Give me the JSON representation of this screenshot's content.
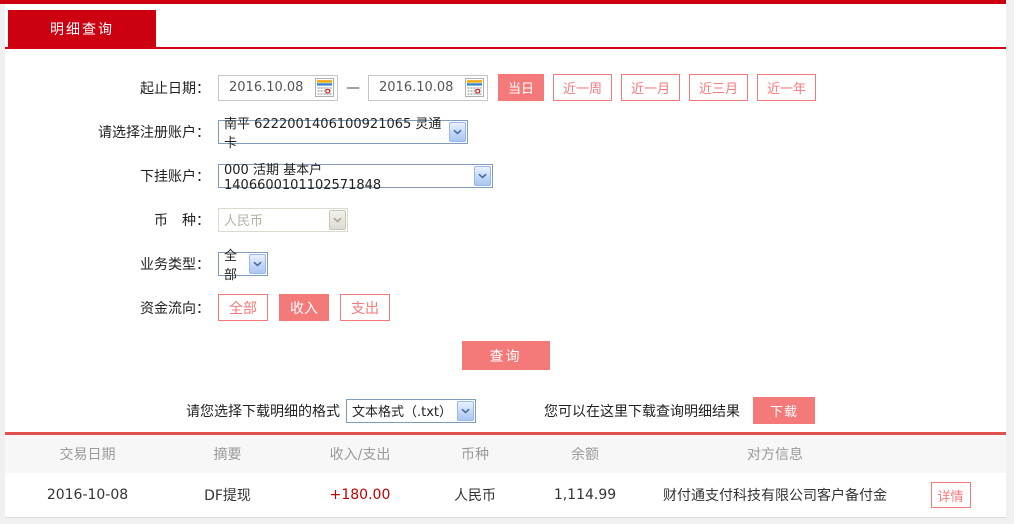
{
  "page": {
    "tab_title": "明细查询"
  },
  "form": {
    "date_range": {
      "label": "起止日期：",
      "start_value": "2016.10.08",
      "end_value": "2016.10.08",
      "separator": "—",
      "quick_buttons": [
        {
          "label": "当日",
          "active": true
        },
        {
          "label": "近一周",
          "active": false
        },
        {
          "label": "近一月",
          "active": false
        },
        {
          "label": "近三月",
          "active": false
        },
        {
          "label": "近一年",
          "active": false
        }
      ]
    },
    "registered_account": {
      "label": "请选择注册账户：",
      "value": "南平 6222001406100921065 灵通卡"
    },
    "sub_account": {
      "label": "下挂账户：",
      "value": "000 活期 基本户 1406600101102571848"
    },
    "currency": {
      "label": "币　种：",
      "value": "人民币",
      "disabled": true
    },
    "business_type": {
      "label": "业务类型：",
      "value": "全部"
    },
    "fund_flow": {
      "label": "资金流向：",
      "options": [
        {
          "label": "全部",
          "active": false
        },
        {
          "label": "收入",
          "active": true
        },
        {
          "label": "支出",
          "active": false
        }
      ]
    },
    "query_button": "查询"
  },
  "download": {
    "format_label": "请您选择下载明细的格式",
    "format_value": "文本格式（.txt）",
    "hint": "您可以在这里下载查询明细结果",
    "button": "下载"
  },
  "table": {
    "headers": [
      "交易日期",
      "摘要",
      "收入/支出",
      "币种",
      "余额",
      "对方信息"
    ],
    "rows": [
      {
        "date": "2016-10-08",
        "summary": "DF提现",
        "amount": "+180.00",
        "currency": "人民币",
        "balance": "1,114.99",
        "counterparty": "财付通支付科技有限公司客户备付金",
        "detail_button": "详情"
      }
    ]
  },
  "colors": {
    "brand_red": "#cc0011",
    "accent_pink": "#f47a7a",
    "amount_red": "#c00000"
  }
}
